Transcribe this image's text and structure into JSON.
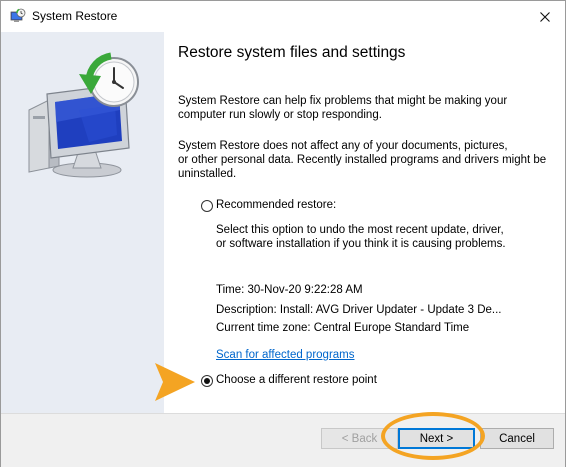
{
  "window": {
    "title": "System Restore",
    "icon": "system-restore-icon",
    "close_icon": "close-icon"
  },
  "main": {
    "heading": "Restore system files and settings",
    "para1_line1": "System Restore can help fix problems that might be making your",
    "para1_line2": "computer run slowly or stop responding.",
    "para2_line1": "System Restore does not affect any of your documents, pictures,",
    "para2_line2": "or other personal data. Recently installed programs and drivers might be",
    "para2_line3": "uninstalled.",
    "options": {
      "recommended_label": "Recommended restore:",
      "recommended_desc_line1": "Select this option to undo the most recent update, driver,",
      "recommended_desc_line2": "or software installation if you think it is causing problems.",
      "time": "Time: 30-Nov-20 9:22:28 AM",
      "description": "Description: Install: AVG Driver Updater - Update 3 De...",
      "timezone": "Current time zone: Central Europe Standard Time",
      "scan_link": "Scan for affected programs",
      "different_label": "Choose a different restore point",
      "selected": "different"
    }
  },
  "footer": {
    "back_label": "< Back",
    "next_label": "Next >",
    "cancel_label": "Cancel"
  },
  "annotations": {
    "accent": "#f4a423",
    "arrow_icon": "pointer-arrow-icon"
  }
}
